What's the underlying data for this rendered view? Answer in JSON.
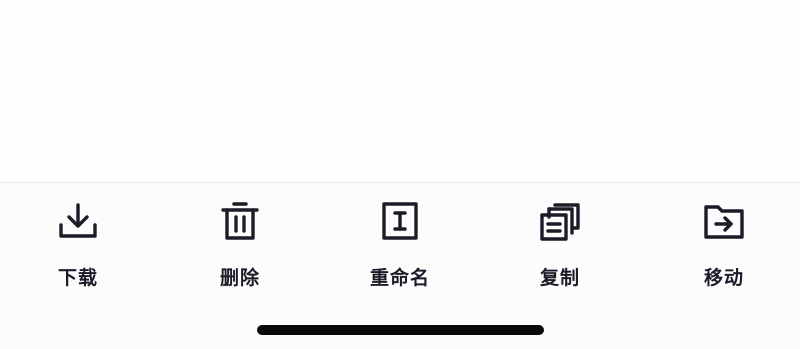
{
  "toolbar": {
    "actions": [
      {
        "label": "下载",
        "icon": "download-icon"
      },
      {
        "label": "删除",
        "icon": "trash-icon"
      },
      {
        "label": "重命名",
        "icon": "rename-icon"
      },
      {
        "label": "复制",
        "icon": "copy-icon"
      },
      {
        "label": "移动",
        "icon": "move-folder-icon"
      }
    ]
  },
  "colors": {
    "icon": "#1c1c28",
    "label": "#1c1c28",
    "home_indicator": "#0a0a0a",
    "divider": "#e9e9ec"
  }
}
